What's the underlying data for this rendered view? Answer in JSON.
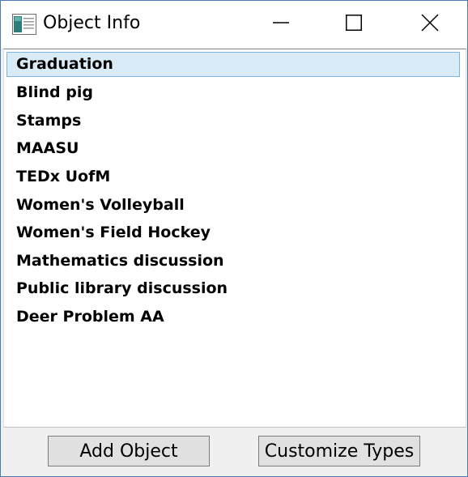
{
  "window": {
    "title": "Object Info",
    "app_icon": "app-window-icon",
    "controls": {
      "minimize_icon": "minimize-icon",
      "maximize_icon": "maximize-icon",
      "close_icon": "close-icon"
    }
  },
  "list": {
    "selected_index": 0,
    "items": [
      "Graduation",
      "Blind pig",
      "Stamps",
      "MAASU",
      "TEDx UofM",
      "Women's Volleyball",
      "Women's Field Hockey",
      "Mathematics discussion",
      "Public library discussion",
      "Deer Problem AA"
    ]
  },
  "buttons": {
    "add_label": "Add Object",
    "customize_label": "Customize Types"
  },
  "colors": {
    "selection_bg": "#d9ebf7",
    "selection_border": "#7fb4de",
    "window_border": "#4a7ab7"
  }
}
